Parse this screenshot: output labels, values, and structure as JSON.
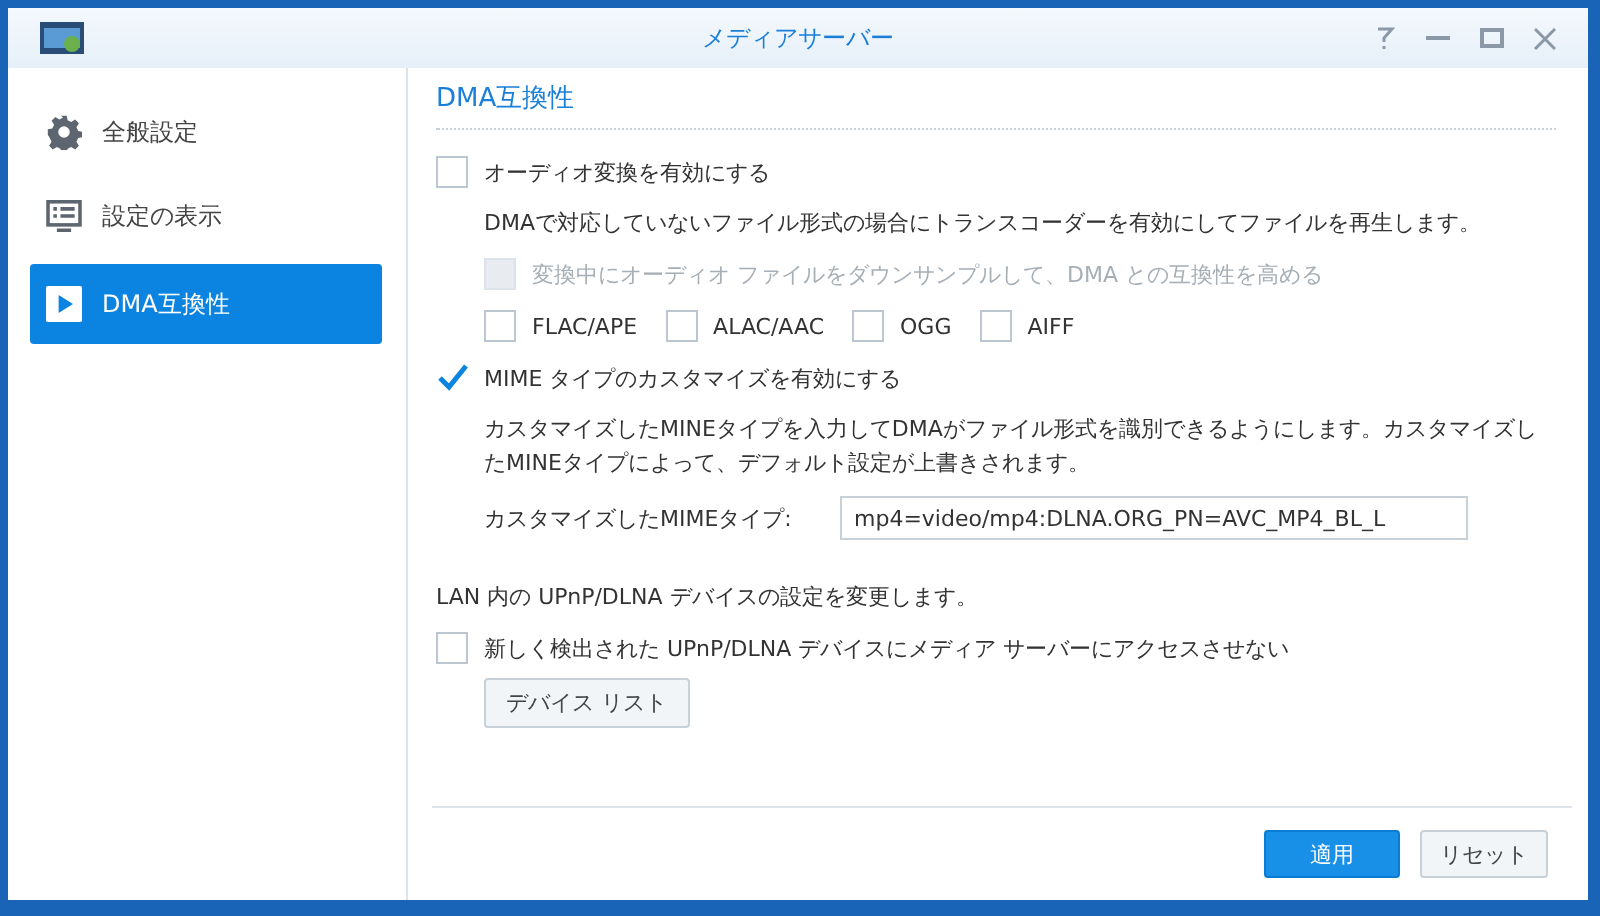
{
  "window": {
    "title": "メディアサーバー"
  },
  "sidebar": {
    "items": [
      {
        "label": "全般設定",
        "kind": "gear",
        "selected": false
      },
      {
        "label": "設定の表示",
        "kind": "list",
        "selected": false
      },
      {
        "label": "DMA互換性",
        "kind": "play",
        "selected": true
      }
    ]
  },
  "content": {
    "heading": "DMA互換性",
    "audio_conversion": {
      "label": "オーディオ変換を有効にする",
      "checked": false
    },
    "audio_description": "DMAで対応していないファイル形式の場合にトランスコーダーを有効にしてファイルを再生します。",
    "downsample": {
      "label": "変換中にオーディオ ファイルをダウンサンプルして、DMA との互換性を高める",
      "checked": false,
      "disabled": true
    },
    "formats": [
      {
        "label": "FLAC/APE",
        "checked": false
      },
      {
        "label": "ALAC/AAC",
        "checked": false
      },
      {
        "label": "OGG",
        "checked": false
      },
      {
        "label": "AIFF",
        "checked": false
      }
    ],
    "mime": {
      "label": "MIME タイプのカスタマイズを有効にする",
      "checked": true
    },
    "mime_description": "カスタマイズしたMINEタイプを入力してDMAがファイル形式を識別できるようにします。カスタマイズしたMINEタイプによって、デフォルト設定が上書きされます。",
    "mime_field": {
      "label": "カスタマイズしたMIMEタイプ:",
      "value": "mp4=video/mp4:DLNA.ORG_PN=AVC_MP4_BL_L"
    },
    "lan_description": "LAN 内の UPnP/DLNA デバイスの設定を変更します。",
    "block_new_devices": {
      "label": "新しく検出された UPnP/DLNA デバイスにメディア サーバーにアクセスさせない",
      "checked": false
    },
    "device_list_button": "デバイス リスト"
  },
  "footer": {
    "buttons": [
      {
        "label": "適用",
        "kind": "primary"
      },
      {
        "label": "リセット",
        "kind": "secondary"
      }
    ]
  }
}
